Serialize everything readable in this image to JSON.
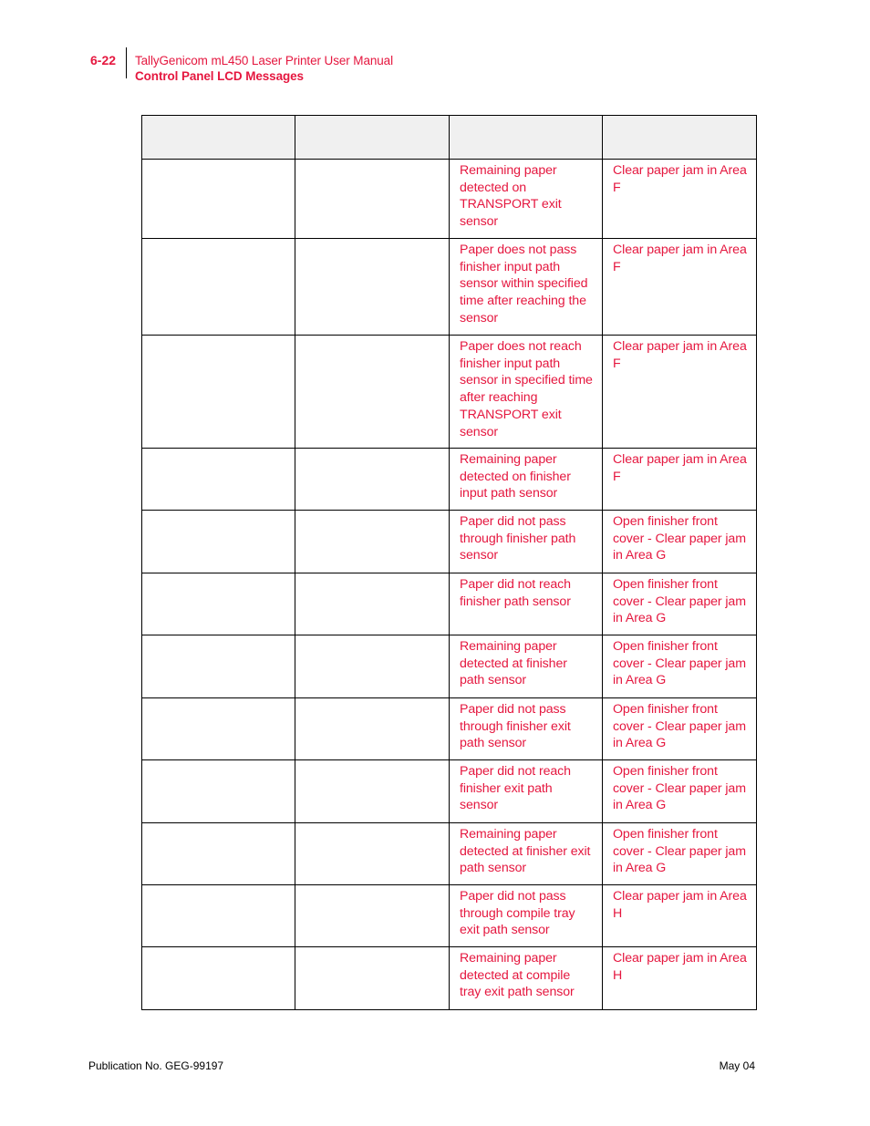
{
  "header": {
    "page_number": "6-22",
    "document_title": "TallyGenicom mL450 Laser Printer User Manual",
    "section_title": "Control Panel LCD Messages"
  },
  "table": {
    "headers": [
      "",
      "",
      "",
      ""
    ],
    "rows": [
      {
        "c1": "",
        "c2": "",
        "cause": "Remaining paper detected on TRANSPORT exit sensor",
        "action": "Clear paper jam in Area F"
      },
      {
        "c1": "",
        "c2": "",
        "cause": "Paper does not pass finisher input path sensor within specified time after reaching the sensor",
        "action": "Clear paper jam in Area F"
      },
      {
        "c1": "",
        "c2": "",
        "cause": "Paper does not reach finisher input path sensor in specified time after reaching TRANSPORT exit sensor",
        "action": "Clear paper jam in Area F"
      },
      {
        "c1": "",
        "c2": "",
        "cause": "Remaining paper detected on finisher input path sensor",
        "action": "Clear paper jam in Area F"
      },
      {
        "c1": "",
        "c2": "",
        "cause": "Paper did not pass through finisher path sensor",
        "action": "Open finisher front cover - Clear paper jam in Area G"
      },
      {
        "c1": "",
        "c2": "",
        "cause": "Paper did not reach finisher path sensor",
        "action": "Open finisher front cover - Clear paper jam in Area G"
      },
      {
        "c1": "",
        "c2": "",
        "cause": "Remaining paper detected at finisher path sensor",
        "action": "Open finisher front cover - Clear paper jam in Area G"
      },
      {
        "c1": "",
        "c2": "",
        "cause": "Paper did not pass through finisher exit path sensor",
        "action": "Open finisher front cover - Clear paper jam in Area G"
      },
      {
        "c1": "",
        "c2": "",
        "cause": "Paper did not reach finisher exit path sensor",
        "action": "Open finisher front cover - Clear paper jam in Area G"
      },
      {
        "c1": "",
        "c2": "",
        "cause": "Remaining paper detected at finisher exit path sensor",
        "action": "Open finisher front cover - Clear paper jam in Area G"
      },
      {
        "c1": "",
        "c2": "",
        "cause": "Paper did not pass through compile tray exit path sensor",
        "action": "Clear paper jam in Area H"
      },
      {
        "c1": "",
        "c2": "",
        "cause": "Remaining paper detected at compile tray exit path sensor",
        "action": "Clear paper jam in Area H"
      }
    ]
  },
  "footer": {
    "publication": "Publication No. GEG-99197",
    "date": "May 04"
  },
  "colors": {
    "accent": "#e5173f",
    "header_row_bg": "#f0f0f0",
    "border": "#000000"
  }
}
